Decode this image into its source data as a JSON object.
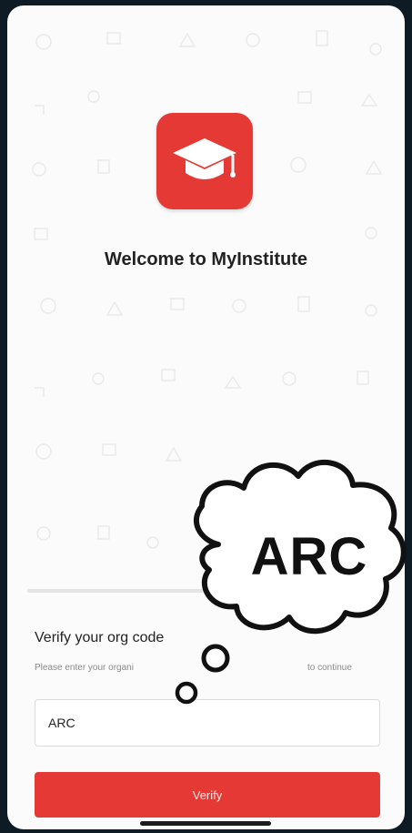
{
  "welcome": {
    "title": "Welcome to MyInstitute"
  },
  "verify": {
    "title": "Verify your org code",
    "subtitle_start": "Please enter your organi",
    "subtitle_end": "to continue",
    "input_value": "ARC",
    "button_label": "Verify"
  },
  "bubble": {
    "text": "ARC"
  },
  "icons": {
    "logo": "graduation-cap-icon",
    "thought": "thought-cloud-icon"
  },
  "colors": {
    "brand": "#e53935",
    "background": "#fbfbfb",
    "text": "#222222"
  }
}
